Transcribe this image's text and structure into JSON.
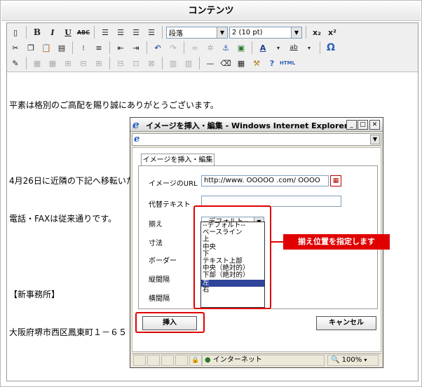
{
  "header": {
    "title": "コンテンツ"
  },
  "toolbar": {
    "row1": {
      "format_select": "段落",
      "size_select": "2 (10 pt)",
      "bold": "B",
      "italic": "I",
      "underline": "U",
      "strike": "ABC",
      "sub": "x₂",
      "sup": "x²"
    },
    "row2": {
      "text_color": "A",
      "highlight": "ab",
      "omega": "Ω"
    },
    "row3": {
      "html": "HTML"
    }
  },
  "content": {
    "lines": [
      "平素は格別のご高配を賜り誠にありがとうございます。",
      "",
      "4月26日に近隣の下記へ移転いたします。",
      "電話・FAXは従来通りです。",
      "",
      "【新事務所】",
      "大阪府堺市西区鳳東町１－６５"
    ]
  },
  "dialog": {
    "title": "イメージを挿入・編集 - Windows Internet Explorer",
    "tab_label": "イメージを挿入・編集",
    "labels": {
      "url": "イメージのURL",
      "alt": "代替テキスト",
      "align": "揃え",
      "size": "寸法",
      "border": "ボーダー",
      "vspace": "縦間隔",
      "hspace": "横間隔"
    },
    "url_value": "http://www. OOOOO .com/ OOOO",
    "alt_value": "",
    "align_selected": "--デフォルト--",
    "align_options": [
      "--デフォルト--",
      "ベースライン",
      "上",
      "中央",
      "下",
      "テキスト上部",
      "中央（絶対的）",
      "下部（絶対的）",
      "左",
      "右"
    ],
    "insert_label": "挿入",
    "cancel_label": "キャンセル",
    "status_zone": "インターネット",
    "zoom": "100%"
  },
  "callout": {
    "text": "揃え位置を指定します"
  },
  "colors": {
    "accent_red": "#e00000",
    "selected": "#30449a"
  }
}
